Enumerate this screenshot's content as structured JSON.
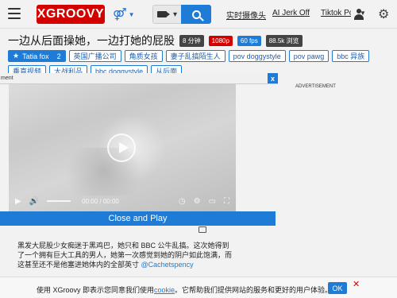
{
  "header": {
    "logo": "XGROOVY",
    "gender_symbol": "⚤",
    "links": [
      "实时摄像头",
      "AI Jerk Off",
      "Tiktok Po"
    ]
  },
  "video": {
    "title": "一边从后面操她，一边打她的屁股",
    "duration": "8 分钟",
    "quality": "1080p",
    "fps": "60 fps",
    "views": "88.5k 浏览",
    "time": "00:00 / 00:00"
  },
  "tags": {
    "pornstar": "Tatia fox",
    "pornstar_count": "2",
    "items": [
      "英国广播公司",
      "角质女孩",
      "妻子乱搞陌生人",
      "pov doggystyle",
      "pov pawg",
      "bbc 异族",
      "垂直视频",
      "大战利品",
      "bbc doggystyle",
      "从后面"
    ]
  },
  "ad": {
    "strip_text": "ment",
    "close": "x",
    "label": "ADVERTISEMENT",
    "close_play": "Close and Play"
  },
  "description": {
    "text": "黑发大屁股少女痴迷于黑鸡巴，她只和 BBC 公牛乱搞。这次她得到了一个拥有巨大工具的男人，她第一次感觉到她的阴户如此饱满，而这甚至还不是他塞进她体内的全部英寸 ",
    "handle": "@Cachetspency"
  },
  "cookie": {
    "text_before": "使用 XGroovy 即表示您同意我们使用",
    "link": "cookie",
    "text_after": "。它帮助我们提供网站的服务和更好的用户体验。",
    "ok": "OK",
    "close": "✕"
  },
  "colors": {
    "brand": "#d40000",
    "accent": "#1e7bd6"
  }
}
